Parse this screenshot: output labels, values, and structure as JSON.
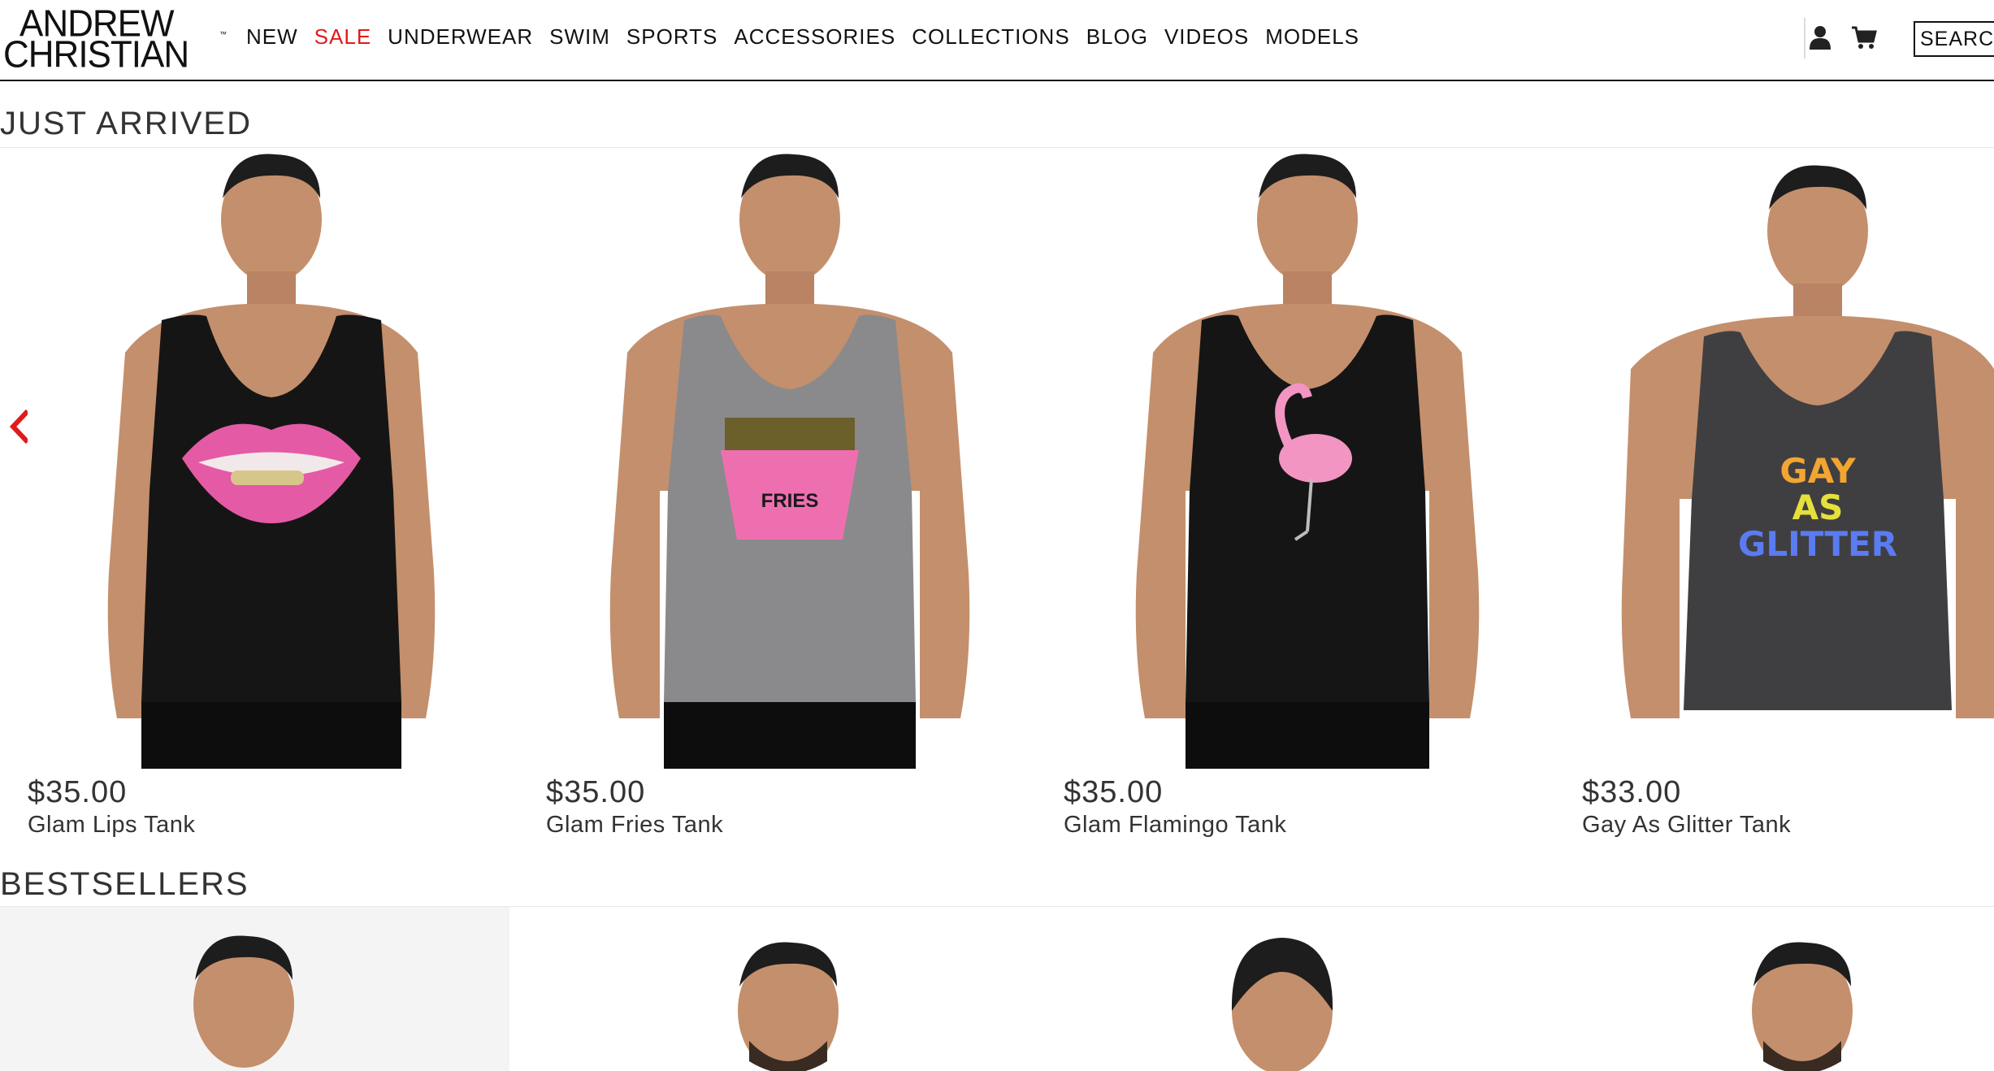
{
  "brand": {
    "line1": "ANDREW",
    "line2": "CHRISTIAN",
    "tm": "™"
  },
  "nav": [
    {
      "label": "NEW"
    },
    {
      "label": "SALE"
    },
    {
      "label": "UNDERWEAR"
    },
    {
      "label": "SWIM"
    },
    {
      "label": "SPORTS"
    },
    {
      "label": "ACCESSORIES"
    },
    {
      "label": "COLLECTIONS"
    },
    {
      "label": "BLOG"
    },
    {
      "label": "VIDEOS"
    },
    {
      "label": "MODELS"
    }
  ],
  "header_icons": [
    "user-icon",
    "cart-icon"
  ],
  "search": {
    "placeholder": "SEARCH"
  },
  "colors": {
    "accent": "#e01b1b",
    "text": "#333333",
    "rule": "#111111"
  },
  "just_arrived": {
    "title": "JUST ARRIVED",
    "products": [
      {
        "price": "$35.00",
        "name": "Glam Lips Tank",
        "tank_color": "#151515",
        "graphic": "lips"
      },
      {
        "price": "$35.00",
        "name": "Glam Fries Tank",
        "tank_color": "#8a8a8c",
        "graphic": "fries",
        "graphic_text": "FRIES"
      },
      {
        "price": "$35.00",
        "name": "Glam Flamingo Tank",
        "tank_color": "#151515",
        "graphic": "flamingo"
      },
      {
        "price": "$33.00",
        "name": "Gay As Glitter Tank",
        "tank_color": "#3f3f42",
        "graphic": "glitter",
        "graphic_lines": [
          "GAY",
          "AS",
          "GLITTER"
        ]
      }
    ]
  },
  "bestsellers": {
    "title": "BESTSELLERS"
  }
}
